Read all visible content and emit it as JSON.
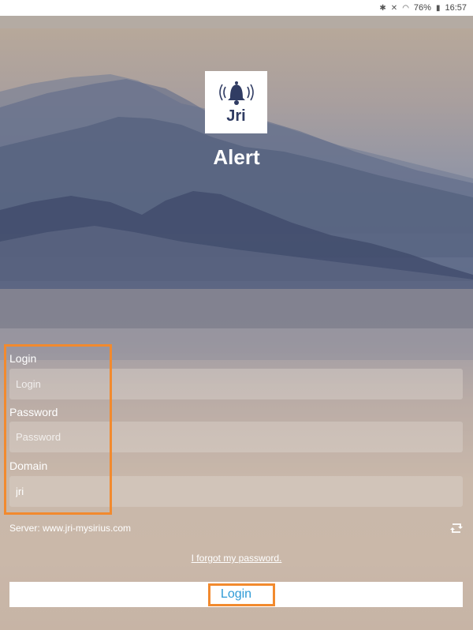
{
  "status_bar": {
    "battery": "76%",
    "time": "16:57",
    "icons": [
      "bluetooth-icon",
      "mute-icon",
      "wifi-icon",
      "battery-icon"
    ]
  },
  "app": {
    "logo_text": "Jri",
    "title": "Alert"
  },
  "form": {
    "login_label": "Login",
    "login_placeholder": "Login",
    "password_label": "Password",
    "password_placeholder": "Password",
    "domain_label": "Domain",
    "domain_value": "jri"
  },
  "server": {
    "text": "Server: www.jri-mysirius.com",
    "switch_icon": "switch-server-icon"
  },
  "forgot_password": "I forgot my password.",
  "login_button": "Login",
  "colors": {
    "accent": "#2f9bd6",
    "highlight": "#f28a2e",
    "logo_navy": "#303c63"
  }
}
